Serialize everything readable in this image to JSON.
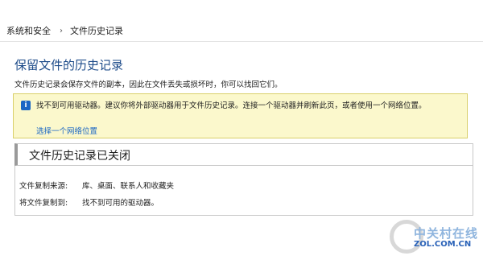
{
  "breadcrumb": {
    "items": [
      "系统和安全",
      "文件历史记录"
    ],
    "separator": "›"
  },
  "page": {
    "title": "保留文件的历史记录",
    "description": "文件历史记录会保存文件的副本，因此在文件丢失或损坏时，你可以找回它们。"
  },
  "warning": {
    "icon": "info-icon",
    "message": "找不到可用驱动器。建议你将外部驱动器用于文件历史记录。连接一个驱动器并刷新此页，或者使用一个网络位置。",
    "link_label": "选择一个网络位置"
  },
  "status": {
    "title": "文件历史记录已关闭",
    "rows": [
      {
        "label": "文件复制来源:",
        "value": "库、桌面、联系人和收藏夹"
      },
      {
        "label": "将文件复制到:",
        "value": "找不到可用的驱动器。"
      }
    ]
  },
  "watermark": {
    "text": "中关村在线",
    "domain": "ZOL.COM.CN"
  },
  "colors": {
    "title_blue": "#1e4c8a",
    "link_blue": "#1a66c4",
    "warning_bg": "#fbf8cc"
  }
}
